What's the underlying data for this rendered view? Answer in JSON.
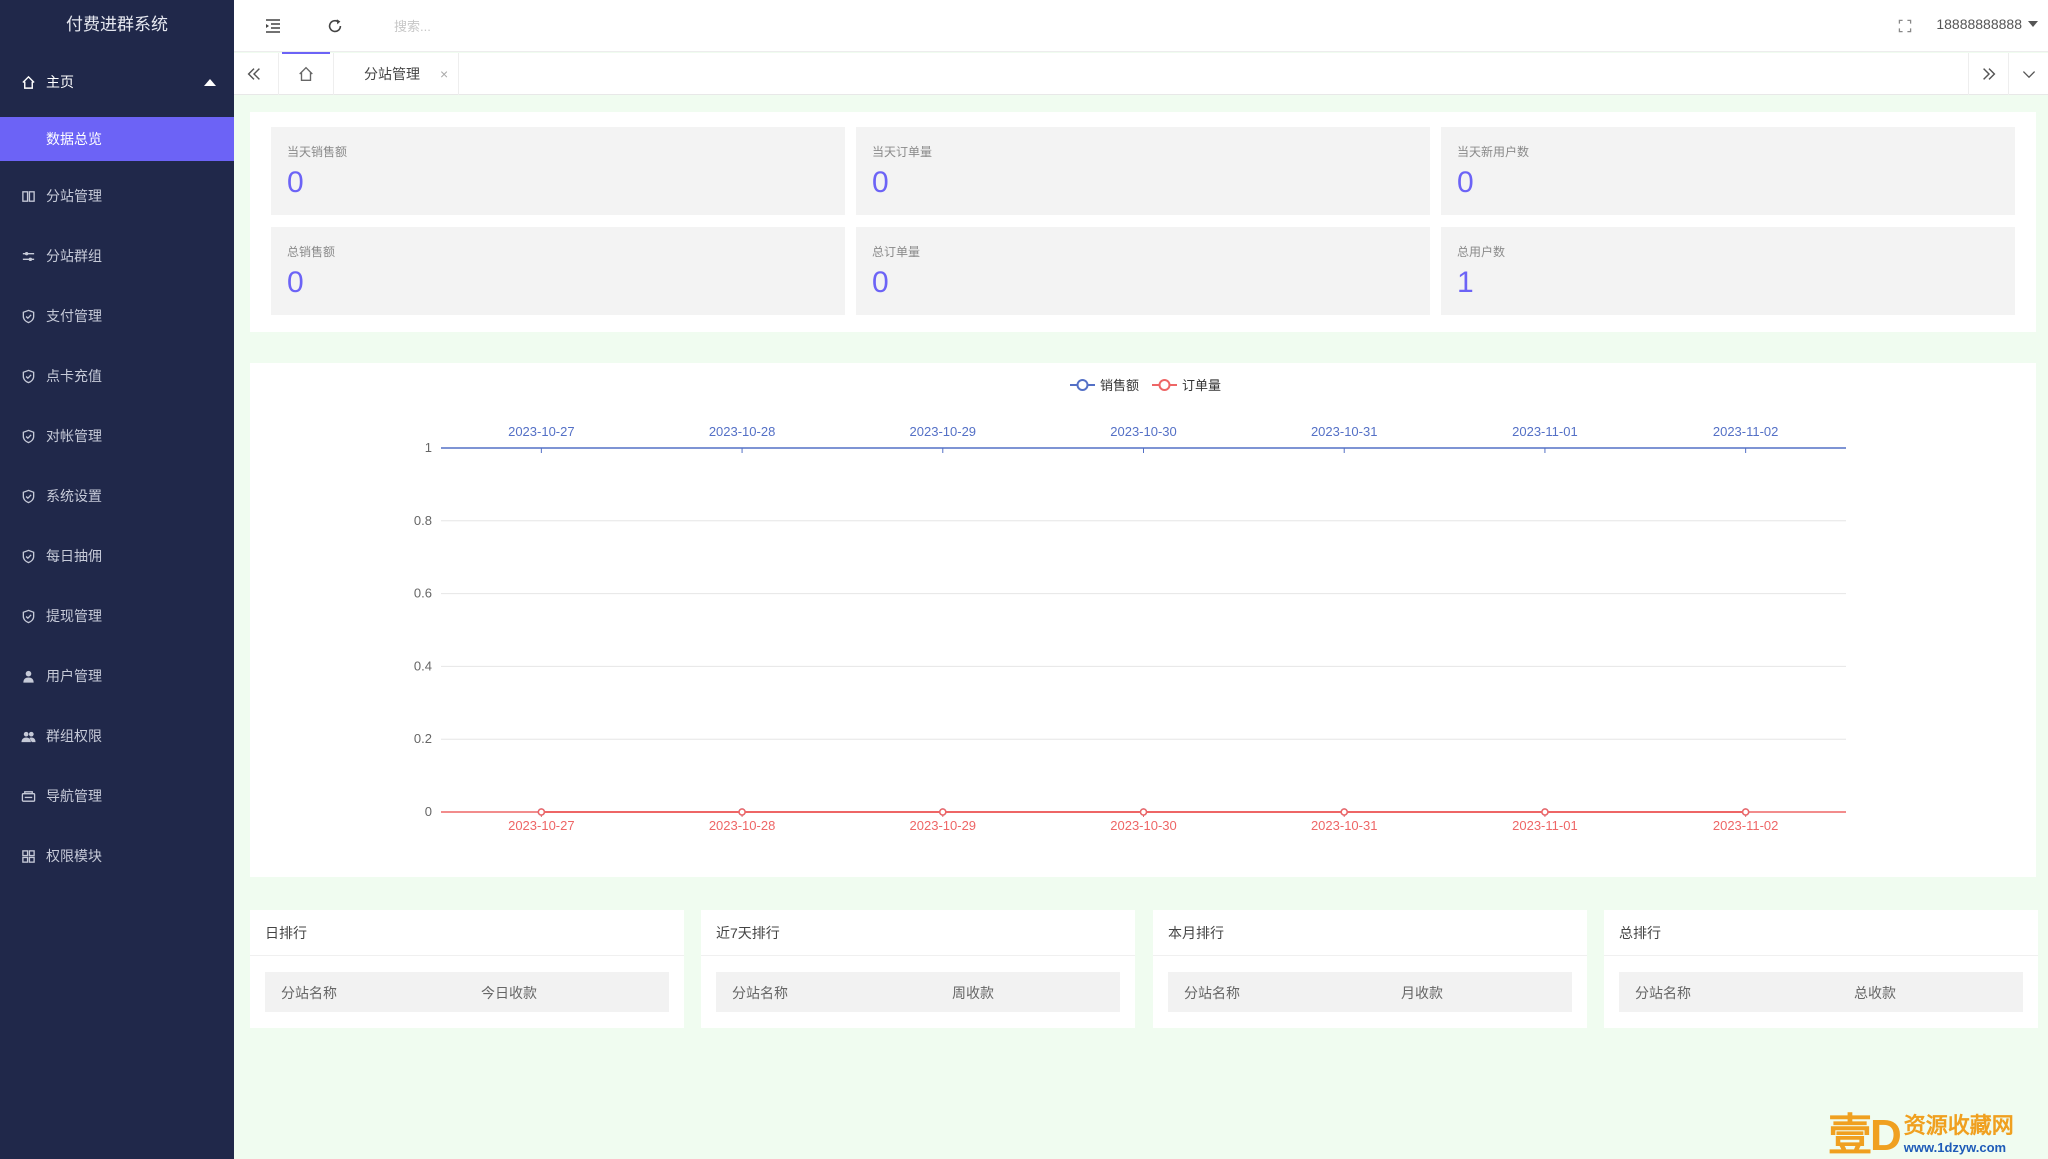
{
  "sidebar": {
    "title": "付费进群系统",
    "home": "主页",
    "active_item": "数据总览",
    "items": [
      {
        "label": "分站管理",
        "icon": "columns-icon"
      },
      {
        "label": "分站群组",
        "icon": "sliders-icon"
      },
      {
        "label": "支付管理",
        "icon": "shield-check-icon"
      },
      {
        "label": "点卡充值",
        "icon": "shield-check-icon"
      },
      {
        "label": "对帐管理",
        "icon": "shield-check-icon"
      },
      {
        "label": "系统设置",
        "icon": "shield-check-icon"
      },
      {
        "label": "每日抽佣",
        "icon": "shield-check-icon"
      },
      {
        "label": "提现管理",
        "icon": "shield-check-icon"
      },
      {
        "label": "用户管理",
        "icon": "user-icon"
      },
      {
        "label": "群组权限",
        "icon": "users-icon"
      },
      {
        "label": "导航管理",
        "icon": "nav-icon"
      },
      {
        "label": "权限模块",
        "icon": "grid-icon"
      }
    ]
  },
  "topbar": {
    "search_placeholder": "搜索...",
    "username": "18888888888"
  },
  "tabs": {
    "current": "分站管理",
    "close_symbol": "×"
  },
  "stats": {
    "row1": [
      {
        "label": "当天销售额",
        "value": "0"
      },
      {
        "label": "当天订单量",
        "value": "0"
      },
      {
        "label": "当天新用户数",
        "value": "0"
      }
    ],
    "row2": [
      {
        "label": "总销售额",
        "value": "0"
      },
      {
        "label": "总订单量",
        "value": "0"
      },
      {
        "label": "总用户数",
        "value": "1"
      }
    ]
  },
  "chart_data": {
    "type": "line",
    "x": [
      "2023-10-27",
      "2023-10-28",
      "2023-10-29",
      "2023-10-30",
      "2023-10-31",
      "2023-11-01",
      "2023-11-02"
    ],
    "series": [
      {
        "name": "销售额",
        "values": [
          0,
          0,
          0,
          0,
          0,
          0,
          0
        ],
        "color": "#5470c6"
      },
      {
        "name": "订单量",
        "values": [
          0,
          0,
          0,
          0,
          0,
          0,
          0
        ],
        "color": "#ee6666"
      }
    ],
    "y_ticks": [
      "1",
      "0.8",
      "0.6",
      "0.4",
      "0.2",
      "0"
    ],
    "ylim": [
      0,
      1
    ],
    "legend": "top-center",
    "grid": true
  },
  "rankings": [
    {
      "title": "日排行",
      "col1": "分站名称",
      "col2": "今日收款"
    },
    {
      "title": "近7天排行",
      "col1": "分站名称",
      "col2": "周收款"
    },
    {
      "title": "本月排行",
      "col1": "分站名称",
      "col2": "月收款"
    },
    {
      "title": "总排行",
      "col1": "分站名称",
      "col2": "总收款"
    }
  ],
  "watermark": {
    "logo": "壹D",
    "name": "资源收藏网",
    "url": "www.1dzyw.com"
  }
}
